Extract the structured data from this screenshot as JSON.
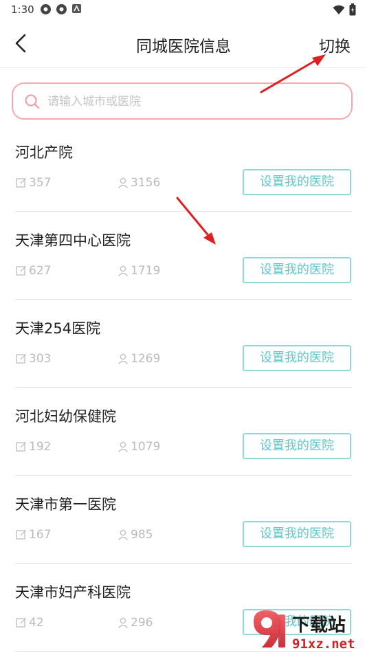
{
  "status_bar": {
    "time": "1:30"
  },
  "header": {
    "title": "同城医院信息",
    "switch_label": "切换"
  },
  "search": {
    "placeholder": "请输入城市或医院"
  },
  "hospitals": [
    {
      "name": "河北产院",
      "posts": "357",
      "users": "3156",
      "button": "设置我的医院"
    },
    {
      "name": "天津第四中心医院",
      "posts": "627",
      "users": "1719",
      "button": "设置我的医院"
    },
    {
      "name": "天津254医院",
      "posts": "303",
      "users": "1269",
      "button": "设置我的医院"
    },
    {
      "name": "河北妇幼保健院",
      "posts": "192",
      "users": "1079",
      "button": "设置我的医院"
    },
    {
      "name": "天津市第一医院",
      "posts": "167",
      "users": "985",
      "button": "设置我的医院"
    },
    {
      "name": "天津市妇产科医院",
      "posts": "42",
      "users": "296",
      "button": "设置我的医院"
    }
  ],
  "watermark": {
    "brand": "下载站",
    "site": "91xz.net"
  },
  "colors": {
    "accent_teal": "#5cc7c9",
    "search_border_pink": "#f6a8ac",
    "annotation_arrow_red": "#e02020"
  }
}
